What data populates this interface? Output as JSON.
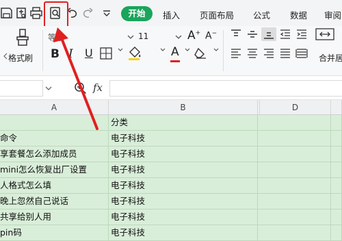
{
  "toolbar": {
    "icons": [
      "save-icon",
      "export-icon",
      "print-icon",
      "print-preview-icon",
      "undo-icon",
      "redo-icon",
      "customize-dropdown-icon"
    ],
    "tabs": [
      {
        "label": "开始",
        "active": true
      },
      {
        "label": "插入"
      },
      {
        "label": "页面布局"
      },
      {
        "label": "公式"
      },
      {
        "label": "数据"
      },
      {
        "label": "审阅"
      }
    ]
  },
  "ribbon": {
    "format_painter_label": "格式刷",
    "font_name": "等线",
    "font_size": "11",
    "merge_label": "合并居"
  },
  "formula_bar": {
    "fx_label": "fx",
    "value": ""
  },
  "columns": [
    "A",
    "B",
    "",
    "D",
    ""
  ],
  "rows": [
    {
      "a": "",
      "b": "分类"
    },
    {
      "a": "命令",
      "b": "电子科技"
    },
    {
      "a": "享套餐怎么添加成员",
      "b": "电子科技"
    },
    {
      "a": "mini怎么恢复出厂设置",
      "b": "电子科技"
    },
    {
      "a": "人格式怎么填",
      "b": "电子科技"
    },
    {
      "a": "晚上忽然自己说话",
      "b": "电子科技"
    },
    {
      "a": "共享给别人用",
      "b": "电子科技"
    },
    {
      "a": "pin码",
      "b": "电子科技"
    }
  ],
  "colors": {
    "accent": "#1aa55c",
    "highlight_box": "#e02020",
    "cell_fill": "#d9eed9"
  }
}
